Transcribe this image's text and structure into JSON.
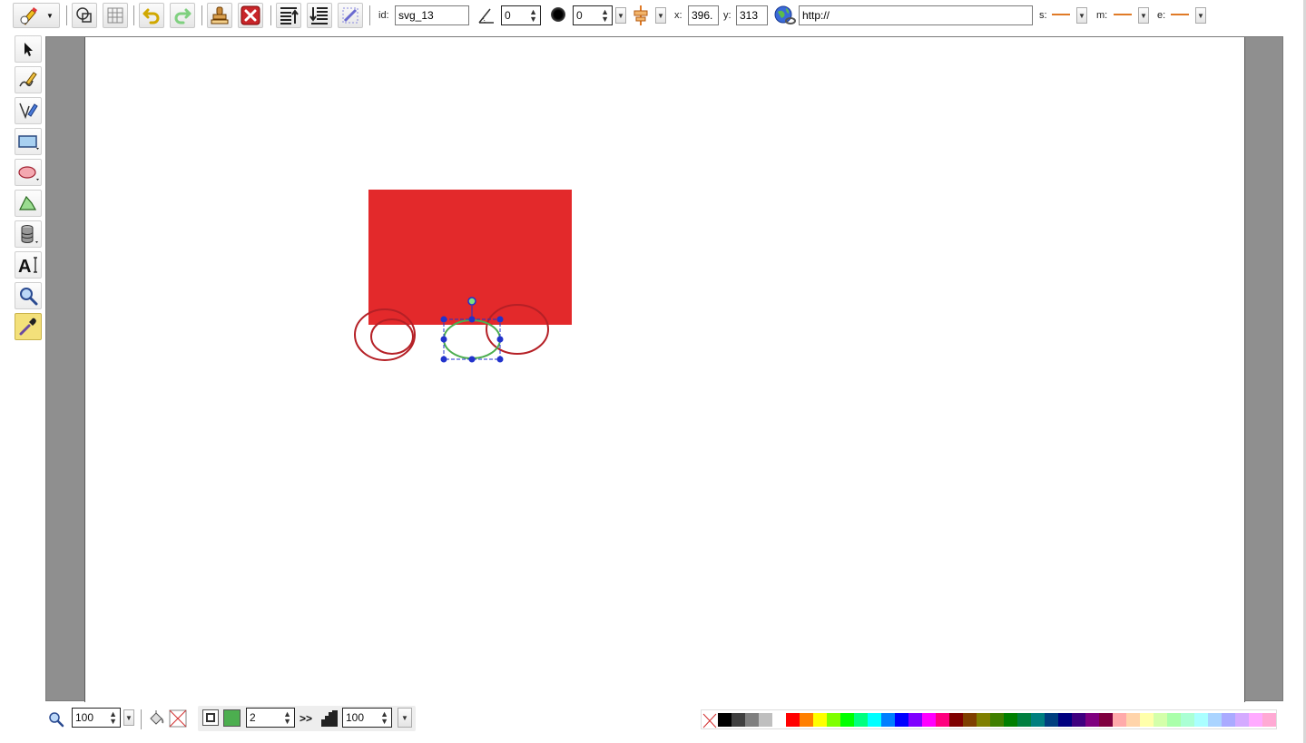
{
  "toolbar": {
    "id_label": "id:",
    "id_value": "svg_13",
    "angle_value": "0",
    "blur_value": "0",
    "x_label": "x:",
    "x_value": "396.",
    "y_label": "y:",
    "y_value": "313",
    "link_value": "http://",
    "marker_start_label": "s:",
    "marker_mid_label": "m:",
    "marker_end_label": "e:"
  },
  "left_tools": [
    {
      "name": "select-tool",
      "icon": "arrow-icon"
    },
    {
      "name": "pencil-tool",
      "icon": "pencil-icon"
    },
    {
      "name": "path-tool",
      "icon": "pen-icon"
    },
    {
      "name": "rect-tool",
      "icon": "rectangle-icon"
    },
    {
      "name": "ellipse-tool",
      "icon": "ellipse-icon"
    },
    {
      "name": "polygon-tool",
      "icon": "polygon-icon"
    },
    {
      "name": "library-tool",
      "icon": "cylinder-icon"
    },
    {
      "name": "text-tool",
      "icon": "text-icon"
    },
    {
      "name": "zoom-tool",
      "icon": "magnifier-icon"
    },
    {
      "name": "eyedropper-tool",
      "icon": "eyedropper-icon",
      "active": true
    }
  ],
  "bottom": {
    "zoom_value": "100",
    "stroke_width_value": "2",
    "opacity_value": "100",
    "more_label": ">>"
  },
  "colors": {
    "selected_fill": "#e3292b",
    "stroke_swatch": "#4cae4f",
    "marker_color": "#e07a26",
    "selection_handle": "#2233cc"
  },
  "palette": [
    "#000000",
    "#3f3f3f",
    "#7f7f7f",
    "#bfbfbf",
    "#ffffff",
    "#ff0000",
    "#ff7f00",
    "#ffff00",
    "#7fff00",
    "#00ff00",
    "#00ff7f",
    "#00ffff",
    "#007fff",
    "#0000ff",
    "#7f00ff",
    "#ff00ff",
    "#ff007f",
    "#7f0000",
    "#7f3f00",
    "#7f7f00",
    "#3f7f00",
    "#007f00",
    "#007f3f",
    "#007f7f",
    "#003f7f",
    "#00007f",
    "#3f007f",
    "#7f007f",
    "#7f003f",
    "#ffaaaa",
    "#ffd4aa",
    "#ffffaa",
    "#d4ffaa",
    "#aaffaa",
    "#aaffd4",
    "#aaffff",
    "#aad4ff",
    "#aaaaff",
    "#d4aaff",
    "#ffaaff",
    "#ffaad4"
  ]
}
